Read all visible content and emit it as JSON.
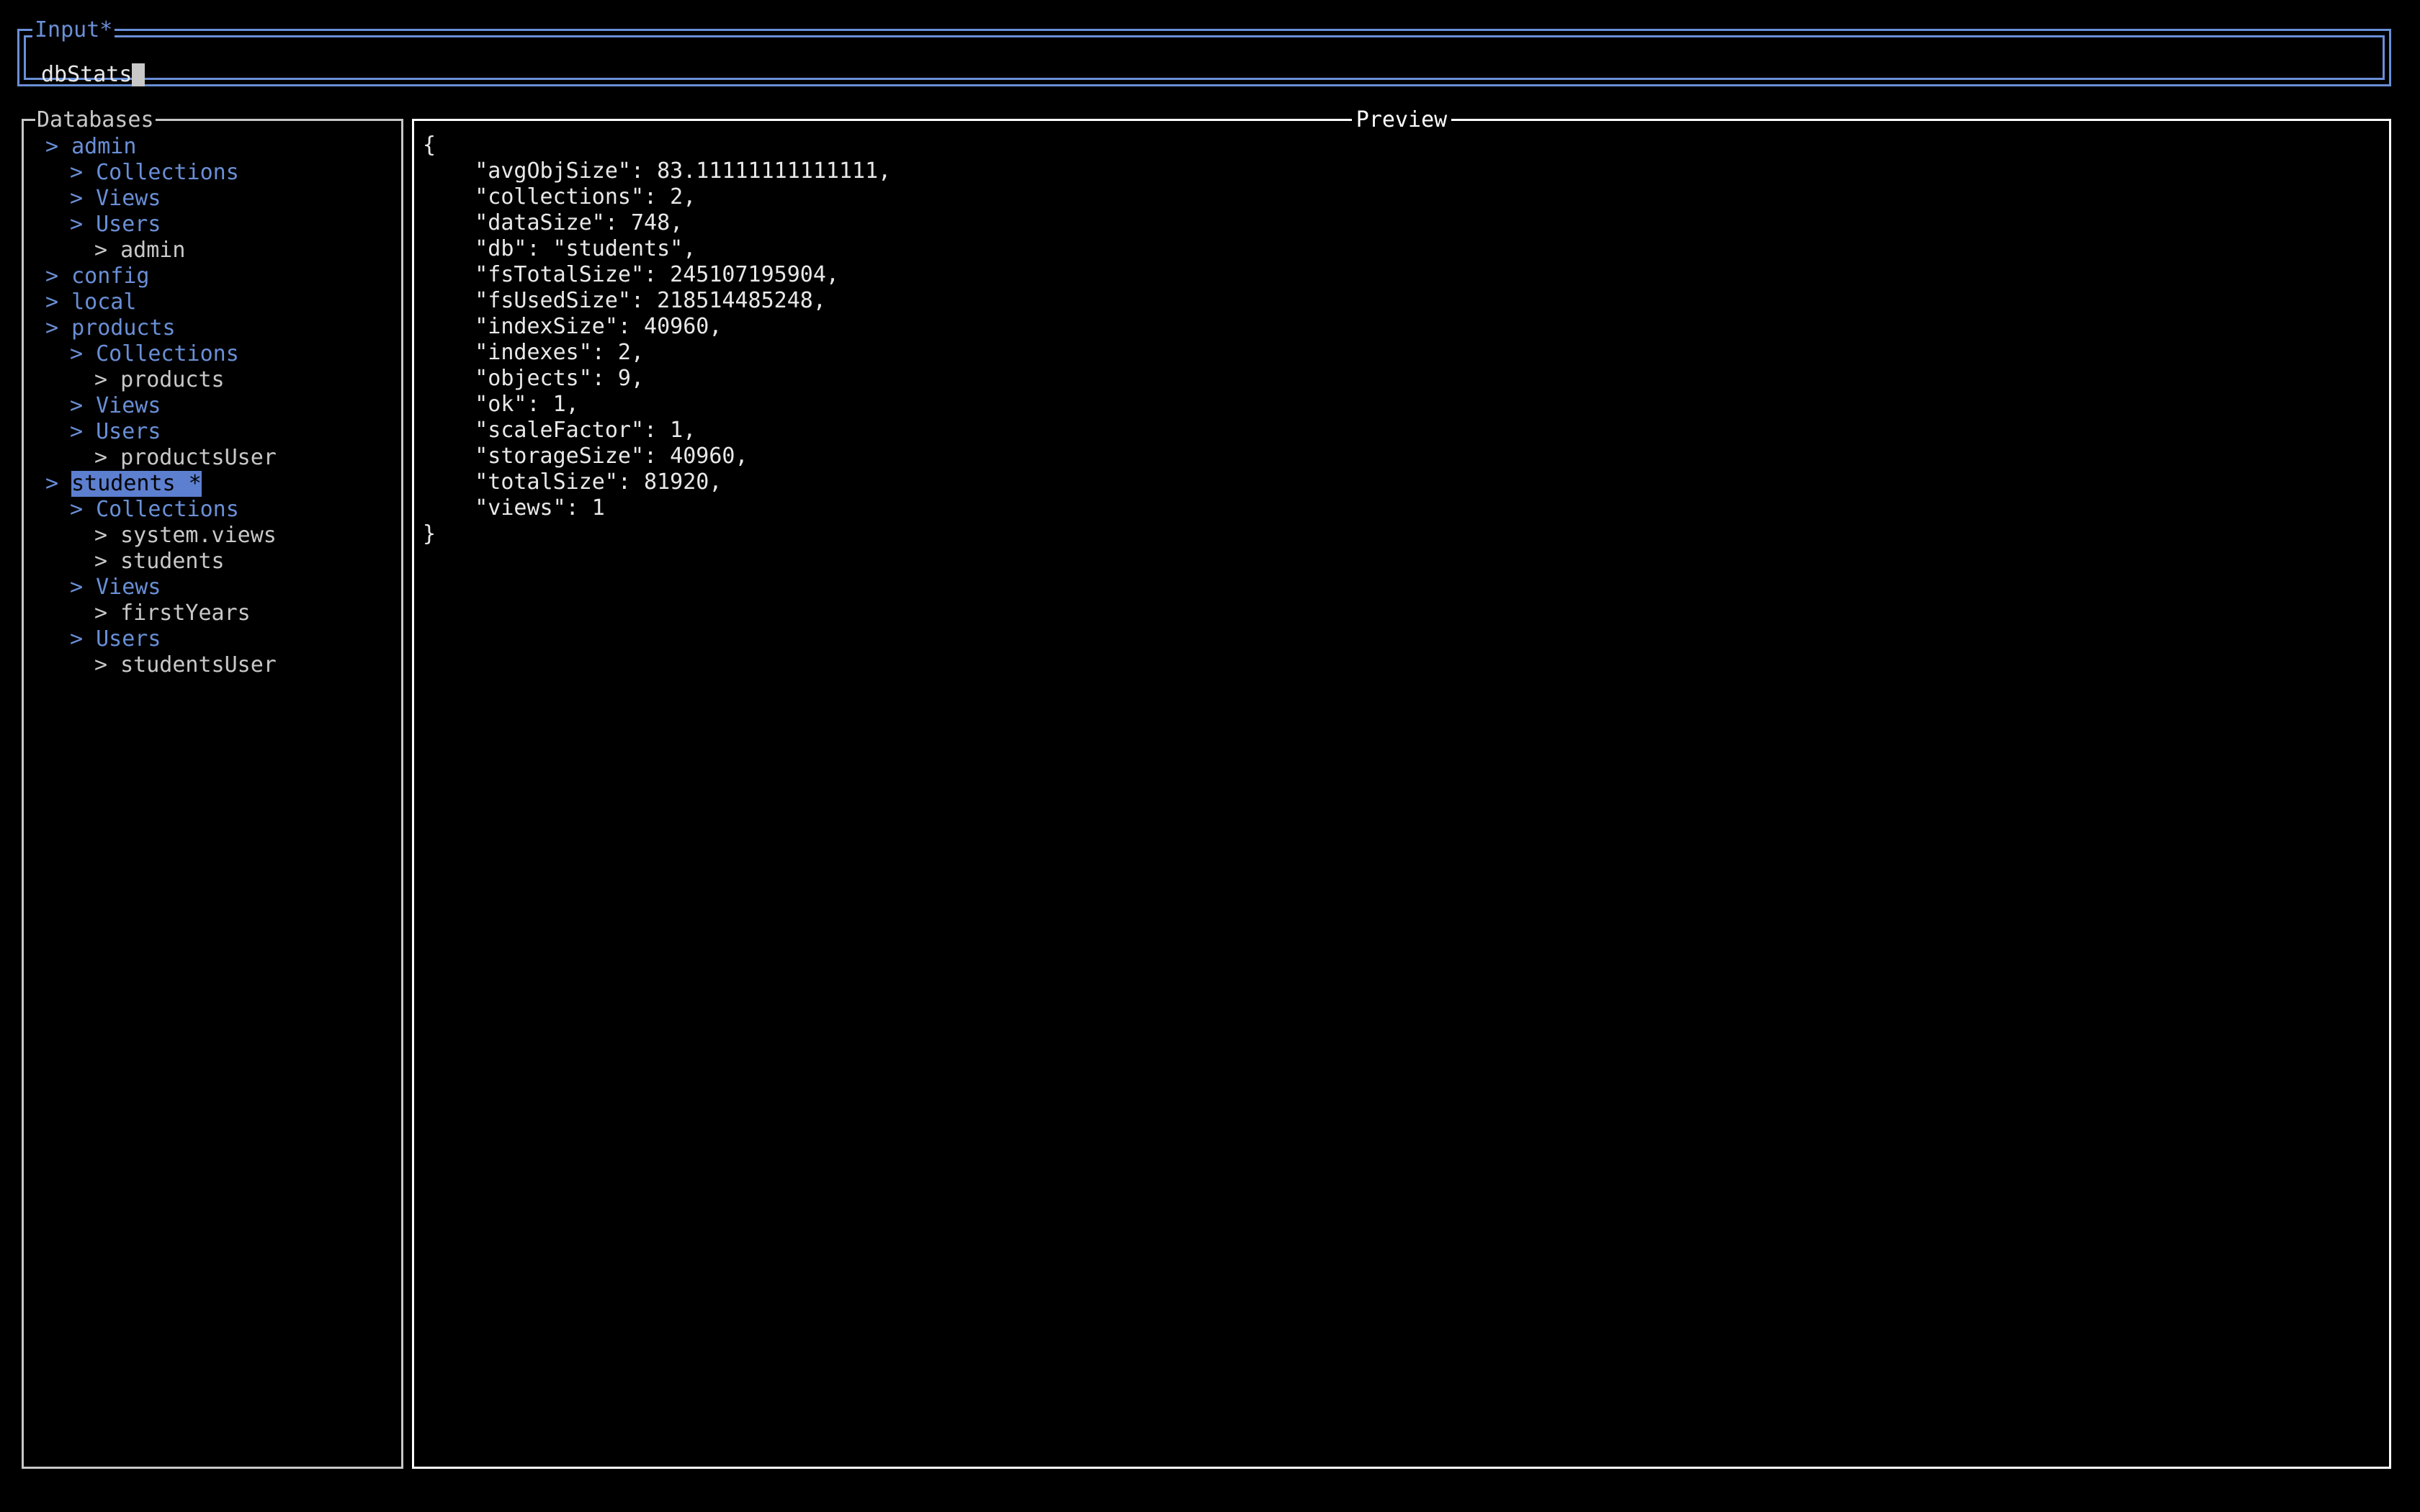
{
  "input": {
    "title": "Input*",
    "value": "dbStats",
    "placeholder": "",
    "border_color": "#6a8fd6",
    "cursor_color": "#c8c8c8"
  },
  "sidebar": {
    "title": "Databases",
    "border_color": "#c8c8c8",
    "accent_color": "#6a8fd6",
    "selection_bg": "#5c7fd0",
    "items": [
      {
        "chevron": ">",
        "label": "admin",
        "indent": 0,
        "color": "blue",
        "selected": false
      },
      {
        "chevron": ">",
        "label": "Collections",
        "indent": 1,
        "color": "blue",
        "selected": false
      },
      {
        "chevron": ">",
        "label": "Views",
        "indent": 1,
        "color": "blue",
        "selected": false
      },
      {
        "chevron": ">",
        "label": "Users",
        "indent": 1,
        "color": "blue",
        "selected": false
      },
      {
        "chevron": ">",
        "label": "admin",
        "indent": 2,
        "color": "white",
        "selected": false
      },
      {
        "chevron": ">",
        "label": "config",
        "indent": 0,
        "color": "blue",
        "selected": false
      },
      {
        "chevron": ">",
        "label": "local",
        "indent": 0,
        "color": "blue",
        "selected": false
      },
      {
        "chevron": ">",
        "label": "products",
        "indent": 0,
        "color": "blue",
        "selected": false
      },
      {
        "chevron": ">",
        "label": "Collections",
        "indent": 1,
        "color": "blue",
        "selected": false
      },
      {
        "chevron": ">",
        "label": "products",
        "indent": 2,
        "color": "white",
        "selected": false
      },
      {
        "chevron": ">",
        "label": "Views",
        "indent": 1,
        "color": "blue",
        "selected": false
      },
      {
        "chevron": ">",
        "label": "Users",
        "indent": 1,
        "color": "blue",
        "selected": false
      },
      {
        "chevron": ">",
        "label": "productsUser",
        "indent": 2,
        "color": "white",
        "selected": false
      },
      {
        "chevron": ">",
        "label": "students *",
        "indent": 0,
        "color": "blue",
        "selected": true
      },
      {
        "chevron": ">",
        "label": "Collections",
        "indent": 1,
        "color": "blue",
        "selected": false
      },
      {
        "chevron": ">",
        "label": "system.views",
        "indent": 2,
        "color": "white",
        "selected": false
      },
      {
        "chevron": ">",
        "label": "students",
        "indent": 2,
        "color": "white",
        "selected": false
      },
      {
        "chevron": ">",
        "label": "Views",
        "indent": 1,
        "color": "blue",
        "selected": false
      },
      {
        "chevron": ">",
        "label": "firstYears",
        "indent": 2,
        "color": "white",
        "selected": false
      },
      {
        "chevron": ">",
        "label": "Users",
        "indent": 1,
        "color": "blue",
        "selected": false
      },
      {
        "chevron": ">",
        "label": "studentsUser",
        "indent": 2,
        "color": "white",
        "selected": false
      }
    ]
  },
  "preview": {
    "title": "Preview",
    "border_color": "#ffffff",
    "text_color": "#e8e8e8",
    "lines": [
      "{",
      "    \"avgObjSize\": 83.11111111111111,",
      "    \"collections\": 2,",
      "    \"dataSize\": 748,",
      "    \"db\": \"students\",",
      "    \"fsTotalSize\": 245107195904,",
      "    \"fsUsedSize\": 218514485248,",
      "    \"indexSize\": 40960,",
      "    \"indexes\": 2,",
      "    \"objects\": 9,",
      "    \"ok\": 1,",
      "    \"scaleFactor\": 1,",
      "    \"storageSize\": 40960,",
      "    \"totalSize\": 81920,",
      "    \"views\": 1",
      "}"
    ],
    "document": {
      "avgObjSize": "83.11111111111111",
      "collections": "2",
      "dataSize": "748",
      "db": "students",
      "fsTotalSize": "245107195904",
      "fsUsedSize": "218514485248",
      "indexSize": "40960",
      "indexes": "2",
      "objects": "9",
      "ok": "1",
      "scaleFactor": "1",
      "storageSize": "40960",
      "totalSize": "81920",
      "views": "1"
    }
  }
}
